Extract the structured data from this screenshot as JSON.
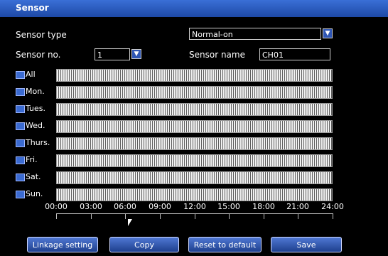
{
  "window": {
    "title": "Sensor"
  },
  "fields": {
    "sensor_type_label": "Sensor type",
    "sensor_type_value": "Normal-on",
    "sensor_no_label": "Sensor no.",
    "sensor_no_value": "1",
    "sensor_name_label": "Sensor name",
    "sensor_name_value": "CH01"
  },
  "days": [
    "All",
    "Mon.",
    "Tues.",
    "Wed.",
    "Thurs.",
    "Fri.",
    "Sat.",
    "Sun."
  ],
  "time_ticks": [
    "00:00",
    "03:00",
    "06:00",
    "09:00",
    "12:00",
    "15:00",
    "18:00",
    "21:00",
    "24:00"
  ],
  "buttons": {
    "linkage": "Linkage setting",
    "copy": "Copy",
    "reset": "Reset to default",
    "save": "Save"
  }
}
